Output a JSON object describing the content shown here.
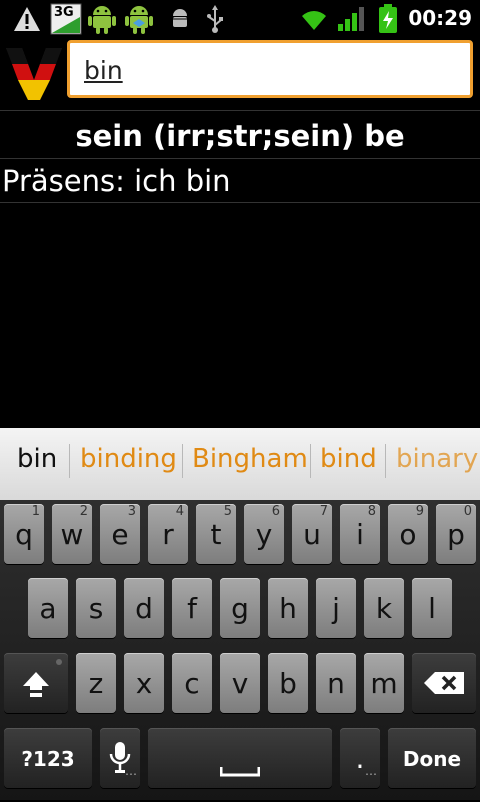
{
  "status_bar": {
    "time": "00:29",
    "network_badge": "3G",
    "icons": [
      "warning-icon",
      "3g-icon",
      "android-icon",
      "android-debug-icon",
      "usb-debug-icon",
      "usb-icon",
      "wifi-icon",
      "signal-icon",
      "battery-icon"
    ]
  },
  "search": {
    "value": "bin"
  },
  "entry": {
    "title": "sein (irr;str;sein) be",
    "body": "Präsens: ich bin"
  },
  "suggestions": {
    "items": [
      "bin",
      "binding",
      "Bingham",
      "bind",
      "binary"
    ]
  },
  "keyboard": {
    "row1": [
      {
        "label": "q",
        "num": "1"
      },
      {
        "label": "w",
        "num": "2"
      },
      {
        "label": "e",
        "num": "3"
      },
      {
        "label": "r",
        "num": "4"
      },
      {
        "label": "t",
        "num": "5"
      },
      {
        "label": "y",
        "num": "6"
      },
      {
        "label": "u",
        "num": "7"
      },
      {
        "label": "i",
        "num": "8"
      },
      {
        "label": "o",
        "num": "9"
      },
      {
        "label": "p",
        "num": "0"
      }
    ],
    "row2": [
      "a",
      "s",
      "d",
      "f",
      "g",
      "h",
      "j",
      "k",
      "l"
    ],
    "row3": [
      "z",
      "x",
      "c",
      "v",
      "b",
      "n",
      "m"
    ],
    "symbols_label": "?123",
    "period_label": ".",
    "done_label": "Done"
  },
  "colors": {
    "accent_orange": "#f0a030",
    "suggestion_text": "#e08a14"
  }
}
